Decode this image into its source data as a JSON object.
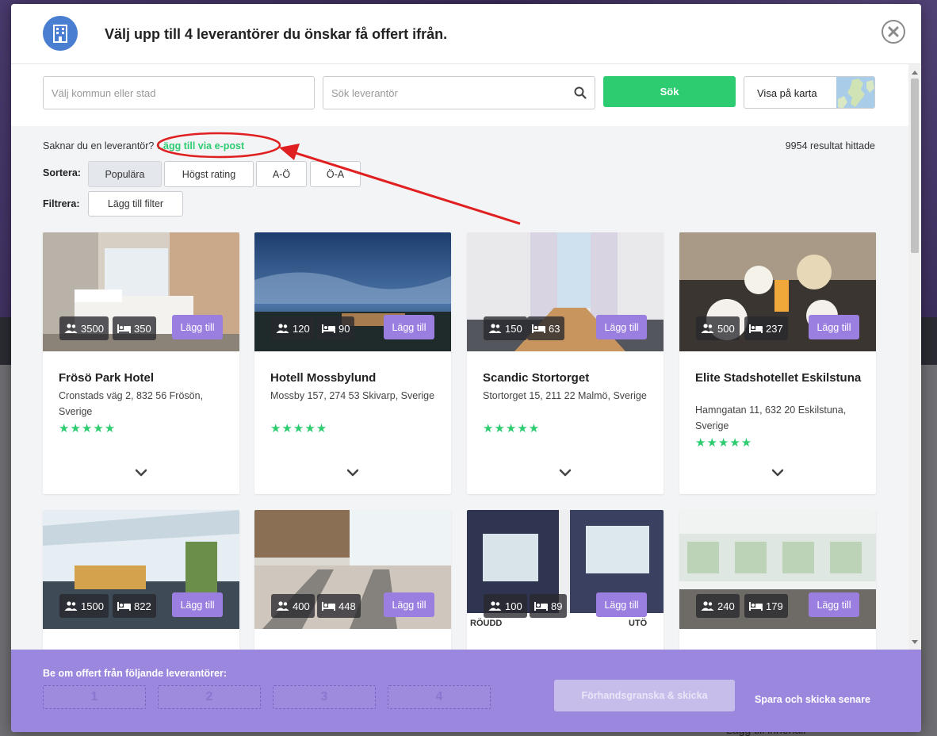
{
  "header": {
    "title": "Välj upp till 4 leverantörer du önskar få offert ifrån."
  },
  "search": {
    "municipality_placeholder": "Välj kommun eller stad",
    "supplier_placeholder": "Sök leverantör",
    "search_button": "Sök",
    "map_button": "Visa på karta"
  },
  "toolbar": {
    "missing_text": "Saknar du en leverantör?",
    "missing_link": "Lägg till via e-post",
    "results": "9954 resultat hittade",
    "sort_label": "Sortera:",
    "sort_options": [
      "Populära",
      "Högst rating",
      "A-Ö",
      "Ö-A"
    ],
    "filter_label": "Filtrera:",
    "filter_button": "Lägg till filter"
  },
  "add_label": "Lägg till",
  "icons": {
    "guests": "users-icon",
    "beds": "bed-icon",
    "chevron": "chevron-down-icon",
    "close": "close-icon",
    "search": "search-icon",
    "building": "building-icon"
  },
  "hotels": [
    {
      "name": "Frösö Park Hotel",
      "address": "Cronstads väg 2, 832 56 Frösön, Sverige",
      "guests": "3500",
      "beds": "350",
      "rating": 5
    },
    {
      "name": "Hotell Mossbylund",
      "address": "Mossby 157, 274 53 Skivarp, Sverige",
      "guests": "120",
      "beds": "90",
      "rating": 5
    },
    {
      "name": "Scandic Stortorget",
      "address": "Stortorget 15, 211 22 Malmö, Sverige",
      "guests": "150",
      "beds": "63",
      "rating": 5
    },
    {
      "name": "Elite Stadshotellet Eskilstuna",
      "address": "Hamngatan 11, 632 20 Eskilstuna, Sverige",
      "guests": "500",
      "beds": "237",
      "rating": 5
    },
    {
      "name": "",
      "address": "",
      "guests": "1500",
      "beds": "822",
      "rating": 0
    },
    {
      "name": "",
      "address": "",
      "guests": "400",
      "beds": "448",
      "rating": 0
    },
    {
      "name": "",
      "address": "",
      "guests": "100",
      "beds": "89",
      "rating": 0,
      "image_text_left": "RÖUDD",
      "image_text_right": "UTÖ"
    },
    {
      "name": "",
      "address": "",
      "guests": "240",
      "beds": "179",
      "rating": 0
    }
  ],
  "footer": {
    "title": "Be om offert från följande leverantörer:",
    "slots": [
      "1",
      "2",
      "3",
      "4"
    ],
    "preview_button": "Förhandsgranska & skicka",
    "later_button": "Spara och skicka senare"
  },
  "background": {
    "footer_text": "Lägg till innehåll"
  },
  "colors": {
    "accent_green": "#2ecc71",
    "accent_purple": "#9b7fe0",
    "footer_purple": "#9b87dd",
    "header_icon_blue": "#4a7ed0",
    "annotation_red": "#e02020"
  }
}
